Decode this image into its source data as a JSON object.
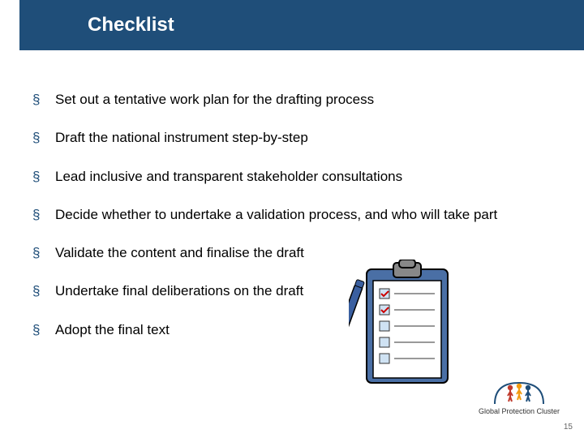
{
  "title": "Checklist",
  "items": [
    "Set out a tentative work plan for the drafting process",
    "Draft the national instrument step-by-step",
    "Lead inclusive and transparent stakeholder consultations",
    "Decide whether to undertake a validation process, and who will take part",
    "Validate the content and finalise the draft",
    "Undertake final deliberations on the draft",
    "Adopt the final text"
  ],
  "logo_text": "Global Protection Cluster",
  "page_number": "15"
}
